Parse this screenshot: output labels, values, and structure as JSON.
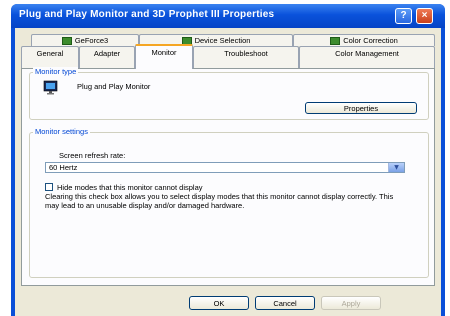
{
  "window": {
    "title": "Plug and Play Monitor and 3D Prophet III Properties"
  },
  "title_buttons": {
    "help": "?",
    "close": "×"
  },
  "tabs_row1": [
    {
      "label": "GeForce3",
      "has_icon": true
    },
    {
      "label": "Device Selection",
      "has_icon": true
    },
    {
      "label": "Color Correction",
      "has_icon": true
    }
  ],
  "tabs_row2": [
    {
      "label": "General"
    },
    {
      "label": "Adapter"
    },
    {
      "label": "Monitor",
      "active": true
    },
    {
      "label": "Troubleshoot"
    },
    {
      "label": "Color Management"
    }
  ],
  "monitor_type": {
    "group_label": "Monitor type",
    "name": "Plug and Play Monitor",
    "properties_button": "Properties"
  },
  "monitor_settings": {
    "group_label": "Monitor settings",
    "refresh_label": "Screen refresh rate:",
    "refresh_value": "60 Hertz",
    "hide_modes_label": "Hide modes that this monitor cannot display",
    "hide_modes_checked": false,
    "description": "Clearing this check box allows you to select display modes that this monitor cannot display correctly. This may lead to an unusable display and/or damaged hardware."
  },
  "footer": {
    "ok": "OK",
    "cancel": "Cancel",
    "apply": "Apply"
  },
  "icons": {
    "monitor": "monitor-icon",
    "combo_arrow": "chevron-down-icon"
  },
  "colors": {
    "title_bar": "#0a52db",
    "group_label": "#0046d5",
    "dialog_bg": "#ece9d8",
    "active_tab_accent": "#f5a623"
  }
}
